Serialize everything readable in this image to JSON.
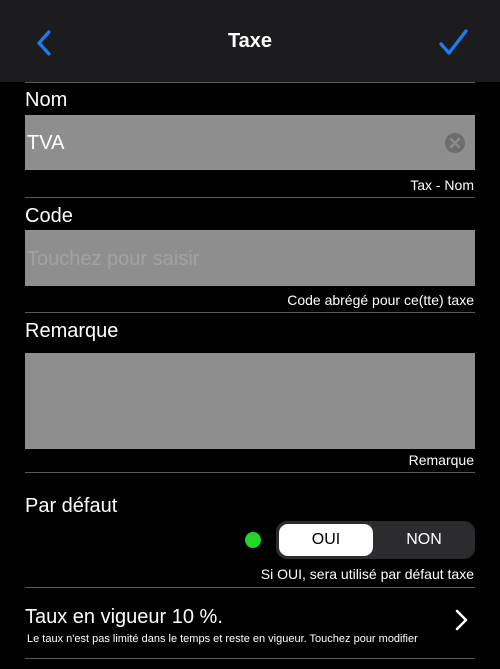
{
  "header": {
    "title": "Taxe",
    "back_icon": "chevron-left-icon",
    "done_icon": "checkmark-icon",
    "accent": "#1f7cf0"
  },
  "nom": {
    "label": "Nom",
    "value": "TVA",
    "hint": "Tax - Nom"
  },
  "code": {
    "label": "Code",
    "placeholder": "Touchez pour saisir",
    "hint": "Code abrégé pour ce(tte) taxe"
  },
  "remarque": {
    "label": "Remarque",
    "value": "",
    "hint": "Remarque"
  },
  "default": {
    "label": "Par défaut",
    "status_color": "#22d52d",
    "options": [
      "OUI",
      "NON"
    ],
    "selected": "OUI",
    "hint": "Si OUI, sera utilisé par défaut taxe"
  },
  "rate": {
    "title": "Taux en vigueur 10 %.",
    "subtitle": "Le taux n'est pas limité dans le temps et reste en vigueur. Touchez pour modifier"
  }
}
